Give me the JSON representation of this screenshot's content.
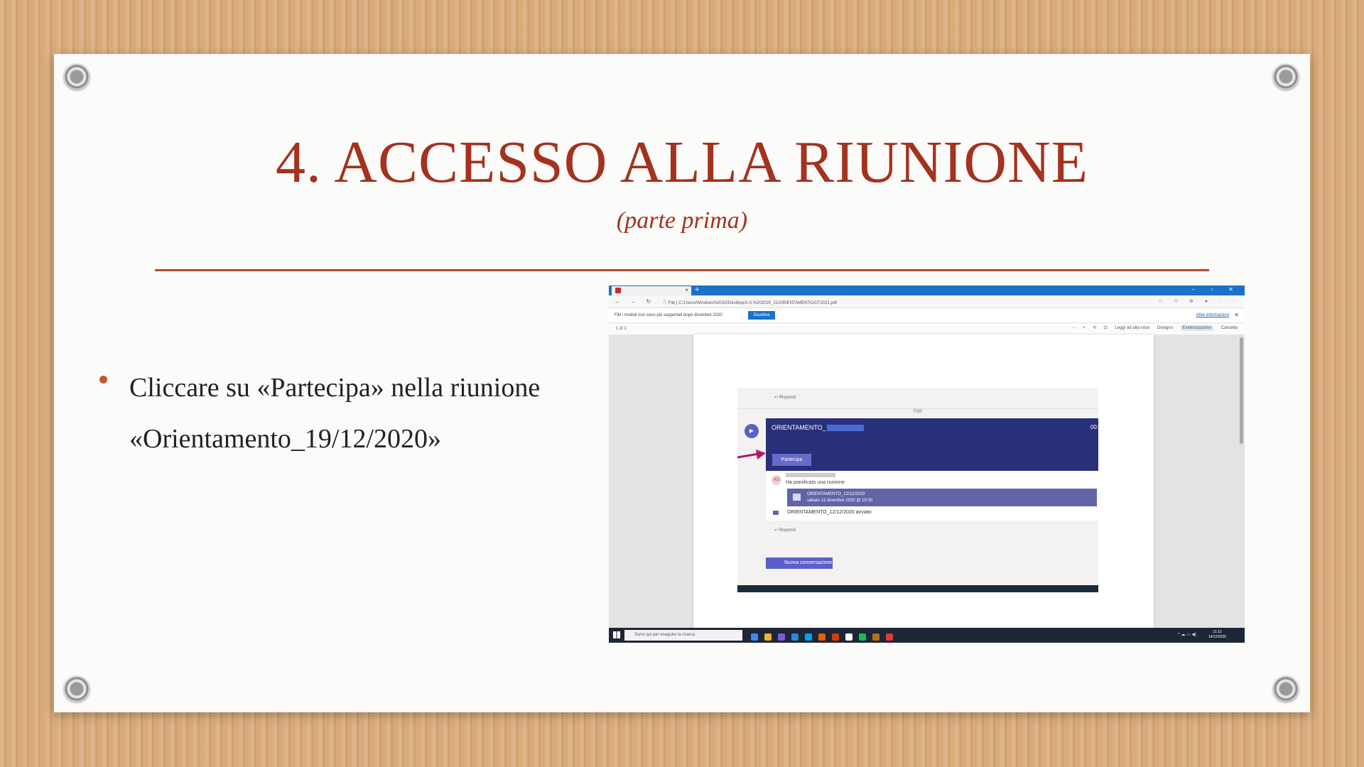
{
  "slide": {
    "title": "4. ACCESSO ALLA RIUNIONE",
    "subtitle": "(parte prima)",
    "bullet_line1": "Cliccare su «Partecipa» nella riunione",
    "bullet_line2": "«Orientamento_19/12/2020»"
  },
  "screenshot": {
    "browser": {
      "new_tab_label": "+",
      "window_controls": "–  ▫  ✕",
      "tab_close": "×",
      "nav_icons": "← → ↻",
      "url": "ⓘ File | C:/Users/Windows%2010/Desktop/A.S.%202020_21/ORIENTAMENTO/OT2021.pdf",
      "infobar_text": "Filli i moduli non sono più supportati dopo dicembre 2020",
      "infobar_button": "Disattiva",
      "infobar_link": "Altre informazioni",
      "infobar_close": "✕",
      "pdf_page": "1   di 1",
      "pdf_tools": [
        "−",
        "+",
        "⟲",
        "⊡",
        "Leggi ad alta voce",
        "Disegno",
        "Evidenziazione",
        "Cancella"
      ]
    },
    "teams": {
      "reply_label": "↩ Rispondi",
      "today_label": "Oggi",
      "meeting_title": "ORIENTAMENTO_",
      "meeting_time": "00:",
      "join_button": "Partecipa",
      "avatar_initials": "AS",
      "post_text": "Ha pianificato una riunione",
      "card_line1": "ORIENTAMENTO_12/12/2020",
      "card_line2": "sabato 12 dicembre 2020 @ 15:00",
      "sent_text": "ORIENTAMENTO_12/12/2020 avviato",
      "reply_label2": "↩ Rispondi",
      "new_conversation": "Nuova conversazione"
    },
    "taskbar": {
      "search_placeholder": "Scrivi qui per eseguire la ricerca",
      "time": "11:13",
      "date": "14/12/2020",
      "app_colors": [
        "#4285f4",
        "#f0b429",
        "#7b5bd6",
        "#2b88d8",
        "#00a2ed",
        "#e66000",
        "#d83b01",
        "#ffffff",
        "#1db954",
        "#b07219",
        "#e53935"
      ]
    }
  },
  "colors": {
    "accent": "#a3321e",
    "rule": "#b5482e",
    "bullet": "#c9542f",
    "teams_meeting": "#29307a",
    "teams_purple": "#6264a7",
    "arrow": "#b5176b"
  }
}
